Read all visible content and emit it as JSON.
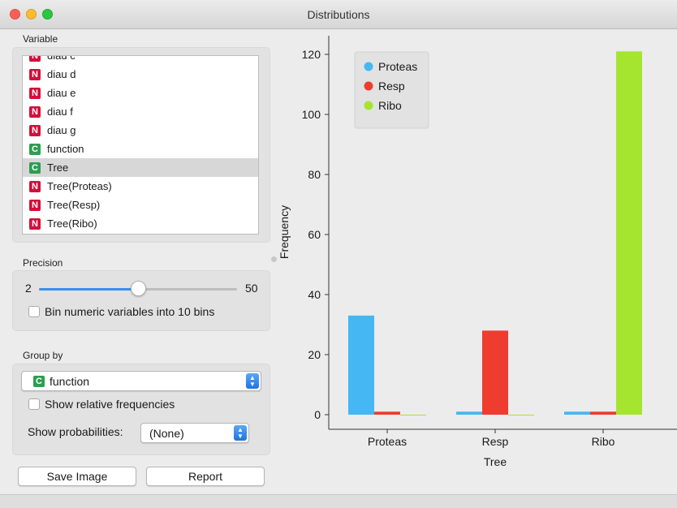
{
  "window": {
    "title": "Distributions"
  },
  "variable": {
    "label": "Variable",
    "items": [
      {
        "type": "N",
        "name": "diau c"
      },
      {
        "type": "N",
        "name": "diau d"
      },
      {
        "type": "N",
        "name": "diau e"
      },
      {
        "type": "N",
        "name": "diau f"
      },
      {
        "type": "N",
        "name": "diau g"
      },
      {
        "type": "C",
        "name": "function"
      },
      {
        "type": "C",
        "name": "Tree",
        "selected": true
      },
      {
        "type": "N",
        "name": "Tree(Proteas)"
      },
      {
        "type": "N",
        "name": "Tree(Resp)"
      },
      {
        "type": "N",
        "name": "Tree(Ribo)"
      }
    ]
  },
  "precision": {
    "label": "Precision",
    "min_label": "2",
    "max_label": "50",
    "slider_fraction": 0.5,
    "bin_checkbox_label": "Bin numeric variables into 10 bins",
    "bin_checked": false
  },
  "group_by": {
    "label": "Group by",
    "selected_type": "C",
    "selected_value": "function",
    "relative_label": "Show relative frequencies",
    "relative_checked": false,
    "probabilities_label": "Show probabilities:",
    "probabilities_value": "(None)"
  },
  "buttons": {
    "save_image": "Save Image",
    "report": "Report"
  },
  "colors": {
    "Proteas": "#45b7f3",
    "Resp": "#ee3c2e",
    "Ribo": "#a5e530",
    "accent": "#3b8ef0"
  },
  "chart_data": {
    "type": "bar",
    "title": "",
    "xlabel": "Tree",
    "ylabel": "Frequency",
    "categories": [
      "Proteas",
      "Resp",
      "Ribo"
    ],
    "series": [
      {
        "name": "Proteas",
        "values": [
          33,
          1,
          1
        ]
      },
      {
        "name": "Resp",
        "values": [
          1,
          28,
          1
        ]
      },
      {
        "name": "Ribo",
        "values": [
          0,
          0,
          121
        ]
      }
    ],
    "ylim": [
      0,
      125
    ],
    "yticks": [
      0,
      20,
      40,
      60,
      80,
      100,
      120
    ],
    "grid": false,
    "legend_position": "top-left"
  }
}
